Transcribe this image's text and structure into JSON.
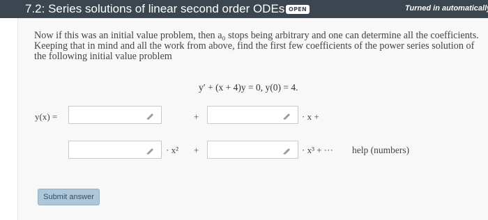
{
  "header": {
    "title": "7.2: Series solutions of linear second order ODEs",
    "badge": "OPEN",
    "status": "Turned in automatically whe"
  },
  "problem": {
    "intro": "Now if this was an initial value problem, then a₀ stops being arbitrary and one can determine all the coefficients. Keeping that in mind and all the work from above, find the first few coefficients of the power series solution of the following initial value problem",
    "equation": "y′ + (x + 4)y = 0,   y(0) = 4."
  },
  "answer": {
    "y_label": "y(x) =",
    "plus": "+",
    "term1_suffix": "· x  +",
    "term2_suffix": "· x²",
    "term3_suffix": "· x³  + ···",
    "help": "help (numbers)",
    "fields": {
      "c0": "",
      "c1": "",
      "c2": "",
      "c3": ""
    }
  },
  "submit_label": "Submit answer",
  "icons": {
    "field_edit": "pencil-icon"
  },
  "colors": {
    "header_bg": "#3b4651",
    "panel_bg": "#f8f8f8",
    "submit_bg": "#aec6d8"
  }
}
